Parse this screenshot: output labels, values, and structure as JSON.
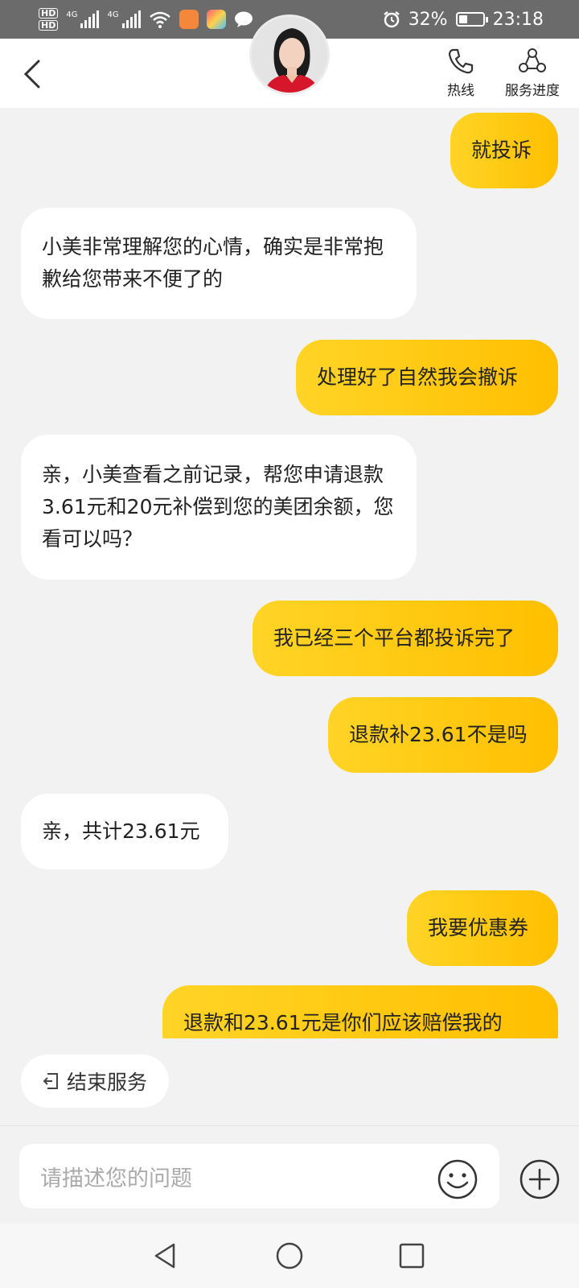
{
  "status_bar": {
    "hd1": "HD",
    "hd2": "HD",
    "net1": "4G",
    "net2": "4G",
    "battery": "32%",
    "battery_level": 0.32,
    "time": "23:18",
    "icons": [
      "signal-icon",
      "wifi-icon",
      "app-notification-icon",
      "app-notification-icon",
      "chat-notification-icon",
      "alarm-icon",
      "battery-icon"
    ]
  },
  "header": {
    "hotline_label": "热线",
    "progress_label": "服务进度"
  },
  "messages": [
    {
      "side": "out",
      "text": "就投诉"
    },
    {
      "side": "in",
      "text": "小美非常理解您的心情，确实是非常抱歉给您带来不便了的"
    },
    {
      "side": "out",
      "text": "处理好了自然我会撤诉"
    },
    {
      "side": "in",
      "text": "亲，小美查看之前记录，帮您申请退款3.61元和20元补偿到您的美团余额，您看可以吗？"
    },
    {
      "side": "out",
      "text": "我已经三个平台都投诉完了"
    },
    {
      "side": "out",
      "text": "退款补23.61不是吗"
    },
    {
      "side": "in",
      "text": "亲，共计23.61元"
    },
    {
      "side": "out",
      "text": "我要优惠券"
    },
    {
      "side": "out",
      "text": "退款和23.61元是你们应该赔偿我的"
    }
  ],
  "end_service_label": "结束服务",
  "input": {
    "placeholder": "请描述您的问题"
  },
  "colors": {
    "accent": "#ffc300",
    "bubble_in": "#ffffff",
    "background": "#f2f2f2"
  }
}
